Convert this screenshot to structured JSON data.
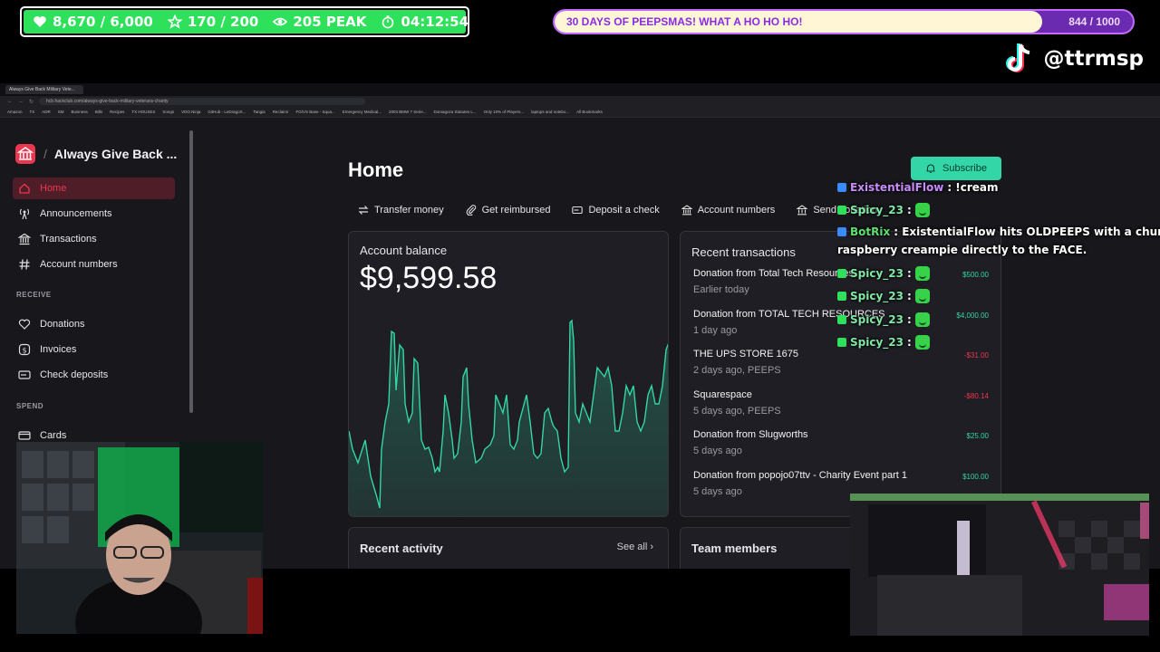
{
  "overlay": {
    "stats": {
      "followers": "8,670 / 6,000",
      "subs": "170 / 200",
      "peak": "205 PEAK",
      "timer": "04:12:54"
    },
    "goal": {
      "text": "30 DAYS OF PEEPSMAS! WHAT A HO HO HO!",
      "count": "844 / 1000",
      "progress": 0.844
    },
    "tiktok_handle": "@ttrmsp",
    "colors": {
      "stats_green": "#2fe15a",
      "goal_purple": "#8b2be2"
    }
  },
  "browser": {
    "tab_title": "Always Give Back Military Vete...",
    "url": "hcb.hackclub.com/always-give-back-military-veterans-charity",
    "bookmarks": [
      "Amazon",
      "TX",
      "ADR",
      "SM",
      "Business",
      "Bills",
      "Recipes",
      "TX HOUSES",
      "Songs",
      "VDO.Ninja",
      "GitHub - LeDragoX...",
      "Tangia",
      "Reclaimr",
      "FG/VS Base - Squa...",
      "Emergency Medical...",
      "2003 BMW 7 Serie...",
      "Domagoza Statutes L...",
      "Only 10% of Players...",
      "laptops and notebo...",
      "All Bookmarks"
    ]
  },
  "sidebar": {
    "org_name": "Always Give Back ...",
    "separator": "/",
    "nav": [
      {
        "label": "Home",
        "icon": "home-icon"
      },
      {
        "label": "Announcements",
        "icon": "broadcast-icon"
      },
      {
        "label": "Transactions",
        "icon": "bank-icon"
      },
      {
        "label": "Account numbers",
        "icon": "hash-icon"
      }
    ],
    "receive_label": "RECEIVE",
    "receive": [
      {
        "label": "Donations",
        "icon": "heart-icon"
      },
      {
        "label": "Invoices",
        "icon": "dollar-icon"
      },
      {
        "label": "Check deposits",
        "icon": "check-icon"
      }
    ],
    "spend_label": "SPEND",
    "spend": [
      {
        "label": "Cards",
        "icon": "card-icon"
      }
    ]
  },
  "main": {
    "title": "Home",
    "subscribe": "Subscribe",
    "actions": [
      {
        "label": "Transfer money",
        "icon": "transfer-icon"
      },
      {
        "label": "Get reimbursed",
        "icon": "attachment-icon"
      },
      {
        "label": "Deposit a check",
        "icon": "check-deposit-icon"
      },
      {
        "label": "Account numbers",
        "icon": "bank-icon"
      },
      {
        "label": "Send donation",
        "icon": "gift-icon"
      }
    ],
    "balance_label": "Account balance",
    "balance": "$9,599.58",
    "recent_transactions_label": "Recent transactions",
    "transactions": [
      {
        "name": "Donation from Total Tech Resources",
        "meta": "Earlier today",
        "amount": "$500.00",
        "positive": true
      },
      {
        "name": "Donation from TOTAL TECH RESOURCES",
        "meta": "1 day ago",
        "amount": "$4,000.00",
        "positive": true
      },
      {
        "name": "THE UPS STORE 1675",
        "meta": "2 days ago, PEEPS",
        "amount": "-$31.00",
        "positive": false
      },
      {
        "name": "Squarespace",
        "meta": "5 days ago, PEEPS",
        "amount": "-$80.14",
        "positive": false
      },
      {
        "name": "Donation from Slugworths",
        "meta": "5 days ago",
        "amount": "$25.00",
        "positive": true
      },
      {
        "name": "Donation from popojo07ttv - Charity Event part 1",
        "meta": "5 days ago",
        "amount": "$100.00",
        "positive": true
      }
    ],
    "recent_activity_label": "Recent activity",
    "see_all": "See all",
    "team_members_label": "Team members",
    "colors": {
      "positive": "#33d6a6",
      "negative": "#ec3750",
      "accent": "#ec3750",
      "chart_line": "#33d6a6"
    }
  },
  "chat": [
    {
      "user": "ExistentialFlow",
      "message": ": !cream",
      "color": "#c98cff"
    },
    {
      "user": "Spicy_23",
      "message": ":",
      "color": "#7fe8a6",
      "emote": true
    },
    {
      "user": "BotRix",
      "message": ": ExistentialFlow hits OLDPEEPS with a chunky",
      "color": "#5ee06f"
    },
    {
      "user": "",
      "message": "raspberry creampie directly to the FACE.",
      "color": "#ffffff"
    },
    {
      "user": "Spicy_23",
      "message": ":",
      "color": "#7fe8a6",
      "emote": true
    },
    {
      "user": "Spicy_23",
      "message": ":",
      "color": "#7fe8a6",
      "emote": true
    },
    {
      "user": "Spicy_23",
      "message": ":",
      "color": "#7fe8a6",
      "emote": true
    },
    {
      "user": "Spicy_23",
      "message": ":",
      "color": "#7fe8a6",
      "emote": true
    }
  ]
}
